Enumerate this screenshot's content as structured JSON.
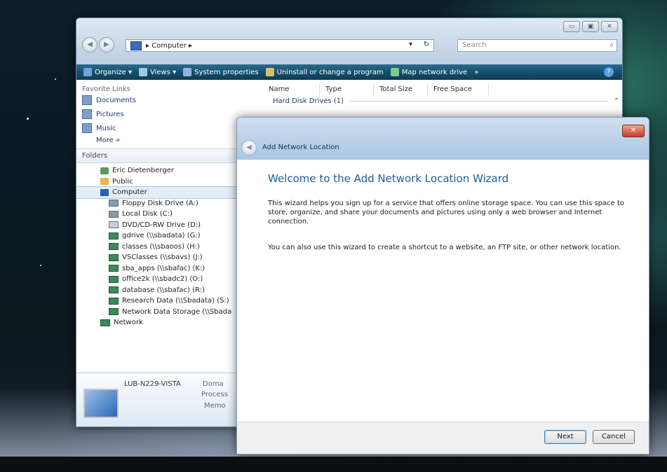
{
  "explorer": {
    "address": {
      "label": "▸ Computer ▸"
    },
    "search": {
      "placeholder": "Search"
    },
    "window_buttons": [
      "▭",
      "▣",
      "✕"
    ],
    "toolbar": [
      {
        "label": "Organize ▾",
        "icon": "organize-icon"
      },
      {
        "label": "Views ▾",
        "icon": "views-icon"
      },
      {
        "label": "System properties",
        "icon": "system-properties-icon"
      },
      {
        "label": "Uninstall or change a program",
        "icon": "uninstall-icon"
      },
      {
        "label": "Map network drive",
        "icon": "map-drive-icon"
      },
      {
        "label": "»",
        "icon": ""
      }
    ],
    "favorites": {
      "header": "Favorite Links",
      "items": [
        "Documents",
        "Pictures",
        "Music"
      ],
      "more": "More »"
    },
    "folders_header": "Folders",
    "tree": [
      {
        "label": "Eric Dietenberger",
        "indent": 1,
        "icon": "user"
      },
      {
        "label": "Public",
        "indent": 1,
        "icon": "pub"
      },
      {
        "label": "Computer",
        "indent": 1,
        "icon": "comp",
        "selected": true
      },
      {
        "label": "Floppy Disk Drive (A:)",
        "indent": 2,
        "icon": "drive"
      },
      {
        "label": "Local Disk (C:)",
        "indent": 2,
        "icon": "drive"
      },
      {
        "label": "DVD/CD-RW Drive (D:)",
        "indent": 2,
        "icon": "dvd"
      },
      {
        "label": "gdrive (\\\\sbadata) (G:)",
        "indent": 2,
        "icon": "net"
      },
      {
        "label": "classes (\\\\sbaoos) (H:)",
        "indent": 2,
        "icon": "net"
      },
      {
        "label": "VSClasses (\\\\sbavs) (J:)",
        "indent": 2,
        "icon": "net"
      },
      {
        "label": "sba_apps (\\\\sbafac) (K:)",
        "indent": 2,
        "icon": "net"
      },
      {
        "label": "office2k (\\\\sbadc2) (O:)",
        "indent": 2,
        "icon": "net"
      },
      {
        "label": "database (\\\\sbafac) (R:)",
        "indent": 2,
        "icon": "net"
      },
      {
        "label": "Research Data (\\\\Sbadata) (S:)",
        "indent": 2,
        "icon": "net"
      },
      {
        "label": "Network Data Storage (\\\\Sbada",
        "indent": 2,
        "icon": "net"
      },
      {
        "label": "Network",
        "indent": 1,
        "icon": "net"
      }
    ],
    "details": {
      "computer_name": "LUB-N229-VISTA",
      "domain_label": "Doma",
      "processor_label": "Process",
      "memory_label": "Memo"
    },
    "columns": [
      "Name",
      "Type",
      "Total Size",
      "Free Space"
    ],
    "group_label": "Hard Disk Drives (1)",
    "group_toggle": "⌃"
  },
  "wizard": {
    "title": "Add Network Location",
    "close_label": "✕",
    "back_label": "◀",
    "heading": "Welcome to the Add Network Location Wizard",
    "paragraph1": "This wizard helps you sign up for a service that offers online storage space.  You can use this space to store, organize, and share your documents and pictures using only a web browser and Internet connection.",
    "paragraph2": "You can also use this wizard to create a shortcut to a website, an FTP site, or other network location.",
    "buttons": {
      "next": "Next",
      "cancel": "Cancel"
    }
  }
}
